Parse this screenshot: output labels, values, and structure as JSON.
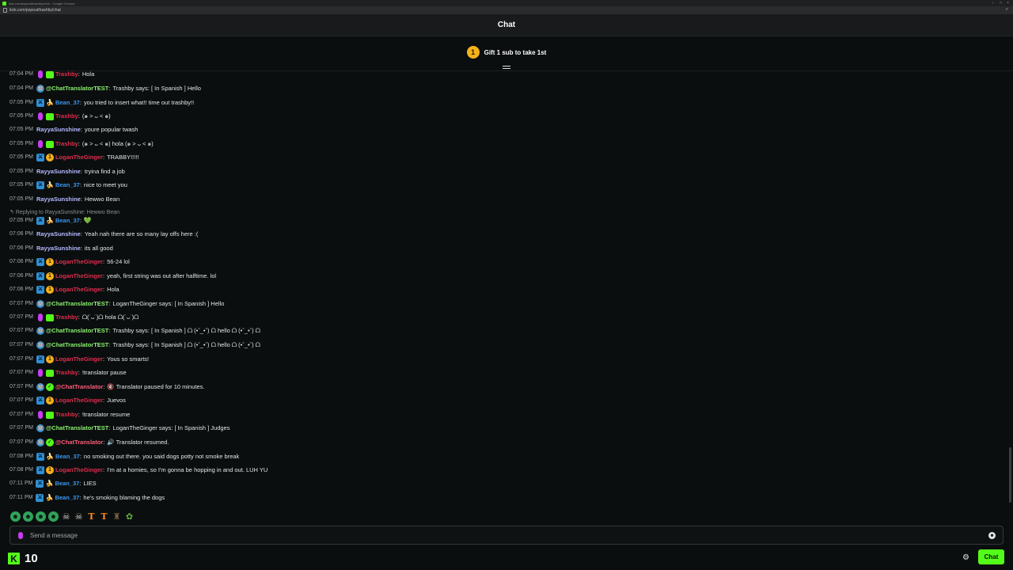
{
  "browser": {
    "window_title": "kick.com/popout/trashby/chat - Google Chrome",
    "url": "kick.com/popout/trashby/chat"
  },
  "header": {
    "title": "Chat"
  },
  "pinned": {
    "gift_count": "1",
    "gift_text": "Gift 1 sub to take 1st"
  },
  "reply_context": "Replying to RayyaSunshine: Hewwo Bean",
  "messages": [
    {
      "time": "07:04 PM",
      "user": "Trashby",
      "color": "#e02d4c",
      "badges": [
        "host",
        "green"
      ],
      "text": "Hola"
    },
    {
      "time": "07:04 PM",
      "user": "@ChatTranslatorTEST",
      "color": "#8bf070",
      "badges": [
        "bot"
      ],
      "text": "Trashby says: [ In Spanish ] Hello"
    },
    {
      "time": "07:05 PM",
      "user": "Bean_37",
      "color": "#3a97f0",
      "badges": [
        "mod",
        "sub"
      ],
      "text": "you tried to insert what!! time out trashby!!"
    },
    {
      "time": "07:05 PM",
      "user": "Trashby",
      "color": "#e02d4c",
      "badges": [
        "host",
        "green"
      ],
      "text": "(๑ > ᴗ < ๑)"
    },
    {
      "time": "07:05 PM",
      "user": "RayyaSunshine",
      "color": "#b4b9ff",
      "badges": [],
      "text": "youre popular twash"
    },
    {
      "time": "07:05 PM",
      "user": "Trashby",
      "color": "#e02d4c",
      "badges": [
        "host",
        "green"
      ],
      "text": "(๑ > ᴗ < ๑) hola (๑ > ᴗ < ๑)"
    },
    {
      "time": "07:05 PM",
      "user": "LoganTheGinger",
      "color": "#e02d4c",
      "badges": [
        "mod",
        "coin"
      ],
      "text": "TRABBY!!!!!"
    },
    {
      "time": "07:05 PM",
      "user": "RayyaSunshine",
      "color": "#b4b9ff",
      "badges": [],
      "text": "tryina find a job"
    },
    {
      "time": "07:05 PM",
      "user": "Bean_37",
      "color": "#3a97f0",
      "badges": [
        "mod",
        "sub"
      ],
      "text": "nice to meet you"
    },
    {
      "time": "07:05 PM",
      "user": "RayyaSunshine",
      "color": "#b4b9ff",
      "badges": [],
      "text": "Hewwo Bean"
    },
    {
      "time": "07:05 PM",
      "user": "Bean_37",
      "color": "#3a97f0",
      "badges": [
        "mod",
        "sub"
      ],
      "text": "",
      "heart": "💚"
    },
    {
      "time": "07:06 PM",
      "user": "RayyaSunshine",
      "color": "#b4b9ff",
      "badges": [],
      "text": "Yeah nah there are so many lay offs here :("
    },
    {
      "time": "07:06 PM",
      "user": "RayyaSunshine",
      "color": "#b4b9ff",
      "badges": [],
      "text": "its all good"
    },
    {
      "time": "07:06 PM",
      "user": "LoganTheGinger",
      "color": "#e02d4c",
      "badges": [
        "mod",
        "coin"
      ],
      "text": "56-24 lol"
    },
    {
      "time": "07:06 PM",
      "user": "LoganTheGinger",
      "color": "#e02d4c",
      "badges": [
        "mod",
        "coin"
      ],
      "text": "yeah, first string was out after halftime. lol"
    },
    {
      "time": "07:06 PM",
      "user": "LoganTheGinger",
      "color": "#e02d4c",
      "badges": [
        "mod",
        "coin"
      ],
      "text": "Hola"
    },
    {
      "time": "07:07 PM",
      "user": "@ChatTranslatorTEST",
      "color": "#8bf070",
      "badges": [
        "bot"
      ],
      "text": "LoganTheGinger says: [ In Spanish ] Hello"
    },
    {
      "time": "07:07 PM",
      "user": "Trashby",
      "color": "#e02d4c",
      "badges": [
        "host",
        "green"
      ],
      "text": "ᗝ(˙ᴗ˙)ᗝ hola ᗝ(˙ᴗ˙)ᗝ"
    },
    {
      "time": "07:07 PM",
      "user": "@ChatTranslatorTEST",
      "color": "#8bf070",
      "badges": [
        "bot"
      ],
      "text": "Trashby says: [ In Spanish ] ᗝ (•ˇ_•ˇ) ᗝ hello ᗝ (•ˇ_•ˇ) ᗝ"
    },
    {
      "time": "07:07 PM",
      "user": "@ChatTranslatorTEST",
      "color": "#8bf070",
      "badges": [
        "bot"
      ],
      "text": "Trashby says: [ In Spanish ] ᗝ (•ˇ_•ˇ) ᗝ hello ᗝ (•ˇ_•ˇ) ᗝ"
    },
    {
      "time": "07:07 PM",
      "user": "LoganTheGinger",
      "color": "#e02d4c",
      "badges": [
        "mod",
        "coin"
      ],
      "text": "Yous so smarts!"
    },
    {
      "time": "07:07 PM",
      "user": "Trashby",
      "color": "#e02d4c",
      "badges": [
        "host",
        "green"
      ],
      "text": "!translator pause"
    },
    {
      "time": "07:07 PM",
      "user": "@ChatTranslator",
      "color": "#ff5c7a",
      "badges": [
        "bot",
        "verified"
      ],
      "text": "🔇 Translator paused for 10 minutes."
    },
    {
      "time": "07:07 PM",
      "user": "LoganTheGinger",
      "color": "#e02d4c",
      "badges": [
        "mod",
        "coin"
      ],
      "text": "Juevos"
    },
    {
      "time": "07:07 PM",
      "user": "Trashby",
      "color": "#e02d4c",
      "badges": [
        "host",
        "green"
      ],
      "text": "!translator resume"
    },
    {
      "time": "07:07 PM",
      "user": "@ChatTranslatorTEST",
      "color": "#8bf070",
      "badges": [
        "bot"
      ],
      "text": "LoganTheGinger says: [ In Spanish ] Judges"
    },
    {
      "time": "07:07 PM",
      "user": "@ChatTranslator",
      "color": "#ff5c7a",
      "badges": [
        "bot",
        "verified"
      ],
      "text": "🔊 Translator resumed."
    },
    {
      "time": "07:08 PM",
      "user": "Bean_37",
      "color": "#3a97f0",
      "badges": [
        "mod",
        "sub"
      ],
      "text": "no smoking out there. you said dogs potty not smoke break"
    },
    {
      "time": "07:08 PM",
      "user": "LoganTheGinger",
      "color": "#e02d4c",
      "badges": [
        "mod",
        "coin"
      ],
      "text": "I'm at a homies, so I'm gonna be hopping in and out. LUH YU"
    },
    {
      "time": "07:11 PM",
      "user": "Bean_37",
      "color": "#3a97f0",
      "badges": [
        "mod",
        "sub"
      ],
      "text": "LIES"
    },
    {
      "time": "07:11 PM",
      "user": "Bean_37",
      "color": "#3a97f0",
      "badges": [
        "mod",
        "sub"
      ],
      "text": "he's smoking blaming the dogs"
    }
  ],
  "emotes": [
    "kick-emote-1",
    "kick-emote-2",
    "kick-emote-3",
    "kick-emote-4",
    "skull-emote",
    "skull-emote-2",
    "t-emote",
    "t-emote-2",
    "beer-emote",
    "leaf-emote"
  ],
  "input": {
    "placeholder": "Send a message",
    "value": ""
  },
  "footer": {
    "points": "10",
    "chat_button": "Chat"
  },
  "colors": {
    "accent": "#53fc18",
    "background": "#0b0e0f"
  }
}
